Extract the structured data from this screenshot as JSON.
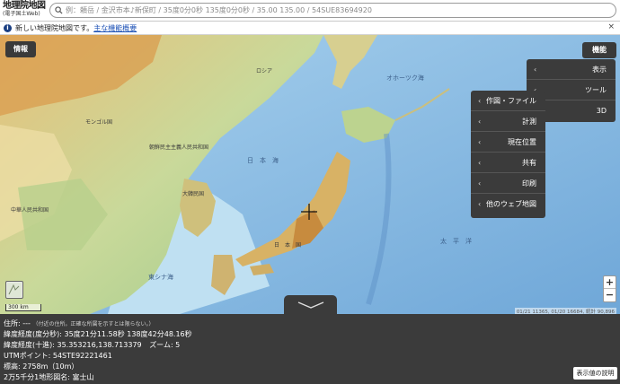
{
  "header": {
    "logo_line1": "地理院地図",
    "logo_line2": "(電子国土Web)",
    "search_placeholder": "例：頼岳 / 金沢市本♪新保町 / 35度0分0秒 135度0分0秒 / 35.00 135.00 / 54SUE83694920"
  },
  "notice": {
    "text": "新しい地理院地図です。",
    "link": "主な機能概要",
    "close": "×"
  },
  "buttons": {
    "info": "情報",
    "functions": "機能"
  },
  "menu_main": {
    "items": [
      {
        "label": "表示",
        "chevron": "‹"
      },
      {
        "label": "ツール",
        "chevron": "‹"
      },
      {
        "label": "3D",
        "chevron": ""
      }
    ]
  },
  "menu_tools": {
    "items": [
      {
        "label": "作図・ファイル",
        "chevron": "‹"
      },
      {
        "label": "計測",
        "chevron": "‹"
      },
      {
        "label": "現在位置",
        "chevron": "‹"
      },
      {
        "label": "共有",
        "chevron": "‹"
      },
      {
        "label": "印刷",
        "chevron": "‹"
      },
      {
        "label": "他のウェブ地図",
        "chevron": "‹"
      }
    ]
  },
  "map": {
    "labels": [
      {
        "text": "日　本　海",
        "kind": "sea"
      },
      {
        "text": "日　本　国",
        "kind": "land"
      },
      {
        "text": "東シナ海",
        "kind": "sea"
      },
      {
        "text": "大韓民国",
        "kind": "land"
      },
      {
        "text": "中華人民共和国",
        "kind": "land"
      },
      {
        "text": "朝鮮民主主義人民共和国",
        "kind": "land"
      },
      {
        "text": "モンゴル国",
        "kind": "land"
      },
      {
        "text": "ロシア",
        "kind": "land"
      },
      {
        "text": "オホーツク海",
        "kind": "sea"
      },
      {
        "text": "太　平　洋",
        "kind": "sea"
      }
    ],
    "scale_label": "300 km",
    "attribution": "01/21 11365, 01/20 16684, 統計 90,896",
    "zoom_in": "+",
    "zoom_out": "−"
  },
  "info_panel": {
    "address_label": "住所: ---",
    "address_note": "（付近の住所。正確な所属を示すとは限らない。）",
    "dms": "緯度経度(度分秒): 35度21分11.58秒 138度42分48.16秒",
    "decimal_label": "緯度経度(十進): 35.353216,138.713379",
    "zoom_level": "ズーム: 5",
    "utm": "UTMポイント: 54STE92221461",
    "elevation": "標高: 2758m（10m）",
    "map_name": "2万5千分1地形図名: 富士山",
    "explain_button": "表示値の説明"
  },
  "colors": {
    "panel_bg": "#3b3b3b",
    "menu_bg": "#3b3b3b",
    "sea": "#9cc7e8",
    "link": "#1a4fb5"
  }
}
